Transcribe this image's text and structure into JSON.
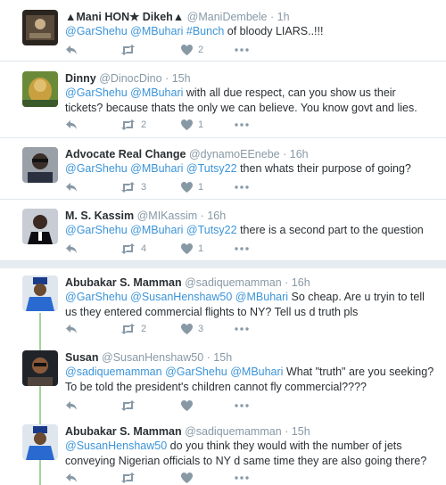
{
  "tweets": [
    {
      "name": "▲Mani HON★ Dikeh▲",
      "handle": "@ManiDembele",
      "time": "1h",
      "text": [
        {
          "t": "@GarShehu",
          "m": true
        },
        {
          "t": " ",
          "m": false
        },
        {
          "t": "@MBuhari",
          "m": true
        },
        {
          "t": " ",
          "m": false
        },
        {
          "t": "#Bunch",
          "m": true
        },
        {
          "t": " of bloody LIARS..!!!",
          "m": false
        }
      ],
      "retweets": "",
      "likes": "2"
    },
    {
      "name": "Dinny",
      "handle": "@DinocDino",
      "time": "15h",
      "text": [
        {
          "t": "@GarShehu",
          "m": true
        },
        {
          "t": " ",
          "m": false
        },
        {
          "t": "@MBuhari",
          "m": true
        },
        {
          "t": " with all due respect, can you show us their tickets? because thats the only we can believe. You know govt and lies.",
          "m": false
        }
      ],
      "retweets": "2",
      "likes": "1"
    },
    {
      "name": "Advocate Real Change",
      "handle": "@dynamoEEnebe",
      "time": "16h",
      "text": [
        {
          "t": "@GarShehu",
          "m": true
        },
        {
          "t": " ",
          "m": false
        },
        {
          "t": "@MBuhari",
          "m": true
        },
        {
          "t": " ",
          "m": false
        },
        {
          "t": "@Tutsy22",
          "m": true
        },
        {
          "t": " then whats their purpose of going?",
          "m": false
        }
      ],
      "retweets": "3",
      "likes": "1"
    },
    {
      "name": "M. S. Kassim",
      "handle": "@MIKassim",
      "time": "16h",
      "text": [
        {
          "t": "@GarShehu",
          "m": true
        },
        {
          "t": " ",
          "m": false
        },
        {
          "t": "@MBuhari",
          "m": true
        },
        {
          "t": " ",
          "m": false
        },
        {
          "t": "@Tutsy22",
          "m": true
        },
        {
          "t": " there is a second part to the question",
          "m": false
        }
      ],
      "retweets": "4",
      "likes": "1"
    },
    {
      "name": "Abubakar S. Mamman",
      "handle": "@sadiquemamman",
      "time": "16h",
      "text": [
        {
          "t": "@GarShehu",
          "m": true
        },
        {
          "t": " ",
          "m": false
        },
        {
          "t": "@SusanHenshaw50",
          "m": true
        },
        {
          "t": " ",
          "m": false
        },
        {
          "t": "@MBuhari",
          "m": true
        },
        {
          "t": " So cheap. Are u tryin to tell us they entered commercial flights to NY? Tell us d truth pls",
          "m": false
        }
      ],
      "retweets": "2",
      "likes": "3"
    },
    {
      "name": "Susan",
      "handle": "@SusanHenshaw50",
      "time": "15h",
      "text": [
        {
          "t": "@sadiquemamman",
          "m": true
        },
        {
          "t": " ",
          "m": false
        },
        {
          "t": "@GarShehu",
          "m": true
        },
        {
          "t": " ",
          "m": false
        },
        {
          "t": "@MBuhari",
          "m": true
        },
        {
          "t": " What \"truth\" are you seeking? To be told the president's children cannot fly commercial????",
          "m": false
        }
      ],
      "retweets": "",
      "likes": ""
    },
    {
      "name": "Abubakar S. Mamman",
      "handle": "@sadiquemamman",
      "time": "15h",
      "text": [
        {
          "t": "@SusanHenshaw50",
          "m": true
        },
        {
          "t": " do you think they would with the number of jets conveying Nigerian officials to NY d same time they are also going there?",
          "m": false
        }
      ],
      "retweets": "",
      "likes": ""
    }
  ],
  "colors": {
    "mention": "#3b94d9",
    "meta": "#8899a6",
    "thread": "#a2d49a",
    "background": "#e6ecf0"
  },
  "icons": {
    "reply": "reply-icon",
    "retweet": "retweet-icon",
    "like": "heart-icon",
    "more": "more-icon"
  }
}
